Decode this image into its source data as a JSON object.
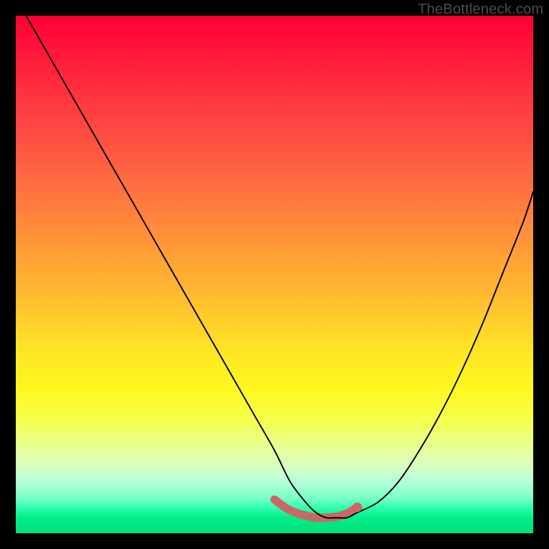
{
  "watermark": "TheBottleneck.com",
  "chart_data": {
    "type": "line",
    "title": "",
    "xlabel": "",
    "ylabel": "",
    "xlim": [
      0,
      100
    ],
    "ylim": [
      0,
      100
    ],
    "series": [
      {
        "name": "bottleneck-curve",
        "x": [
          2,
          6,
          10,
          14,
          18,
          22,
          26,
          30,
          34,
          38,
          42,
          46,
          50,
          53,
          56,
          58,
          60,
          62,
          64,
          66,
          70,
          74,
          78,
          82,
          86,
          90,
          94,
          98,
          100
        ],
        "y": [
          100,
          93,
          86,
          79,
          72,
          65,
          58,
          51,
          44,
          37,
          30,
          23,
          16,
          10,
          6,
          4,
          3,
          3,
          3,
          4,
          6,
          10,
          16,
          23,
          31,
          40,
          50,
          60,
          66
        ],
        "stroke": "#000000",
        "stroke_width": 2
      },
      {
        "name": "highlight-segment",
        "x": [
          50,
          52,
          54,
          56,
          58,
          60,
          62,
          64,
          66
        ],
        "y": [
          6.5,
          5.0,
          4.0,
          3.4,
          3.0,
          3.0,
          3.2,
          3.8,
          5.0
        ],
        "stroke": "#cc6666",
        "stroke_width": 12
      }
    ],
    "endpoints": [
      {
        "x": 66,
        "y": 5.0,
        "r": 7,
        "fill": "#cc6666"
      }
    ],
    "background_gradient": {
      "top": "#ff0033",
      "bottom": "#00e07a"
    }
  }
}
